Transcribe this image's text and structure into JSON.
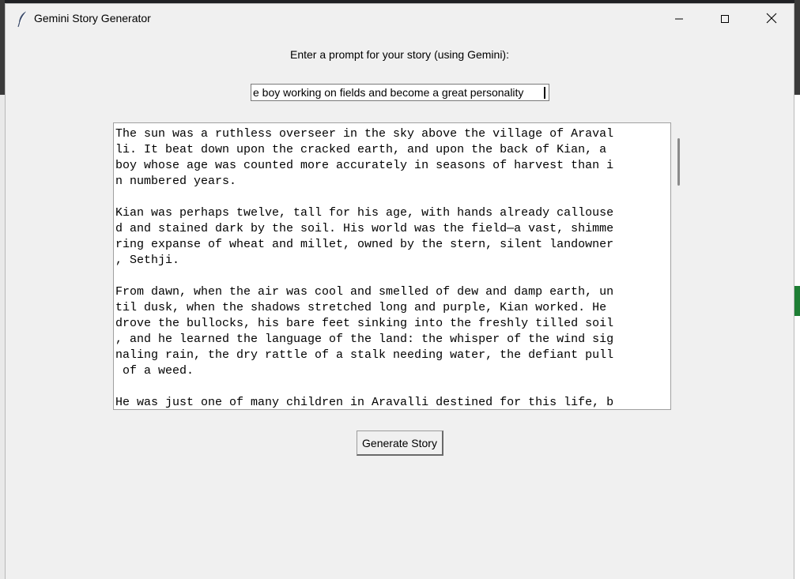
{
  "window": {
    "title": "Gemini Story Generator"
  },
  "prompt": {
    "label": "Enter a prompt for your story (using Gemini):",
    "value": "e boy working on fields and become a great personality"
  },
  "story": {
    "lines": [
      "The sun was a ruthless overseer in the sky above the village of Araval",
      "li. It beat down upon the cracked earth, and upon the back of Kian, a ",
      "boy whose age was counted more accurately in seasons of harvest than i",
      "n numbered years.",
      "",
      "Kian was perhaps twelve, tall for his age, with hands already callouse",
      "d and stained dark by the soil. His world was the field—a vast, shimme",
      "ring expanse of wheat and millet, owned by the stern, silent landowner",
      ", Sethji.",
      "",
      "From dawn, when the air was cool and smelled of dew and damp earth, un",
      "til dusk, when the shadows stretched long and purple, Kian worked. He ",
      "drove the bullocks, his bare feet sinking into the freshly tilled soil",
      ", and he learned the language of the land: the whisper of the wind sig",
      "naling rain, the dry rattle of a stalk needing water, the defiant pull",
      " of a weed.",
      "",
      "He was just one of many children in Aravalli destined for this life, b"
    ]
  },
  "actions": {
    "generate_label": "Generate Story"
  },
  "icons": {
    "app": "feather-icon",
    "minimize": "minimize-icon",
    "maximize": "maximize-icon",
    "close": "close-icon"
  },
  "colors": {
    "window_bg": "#f0f0f0",
    "text_bg": "#ffffff",
    "text": "#000000"
  }
}
